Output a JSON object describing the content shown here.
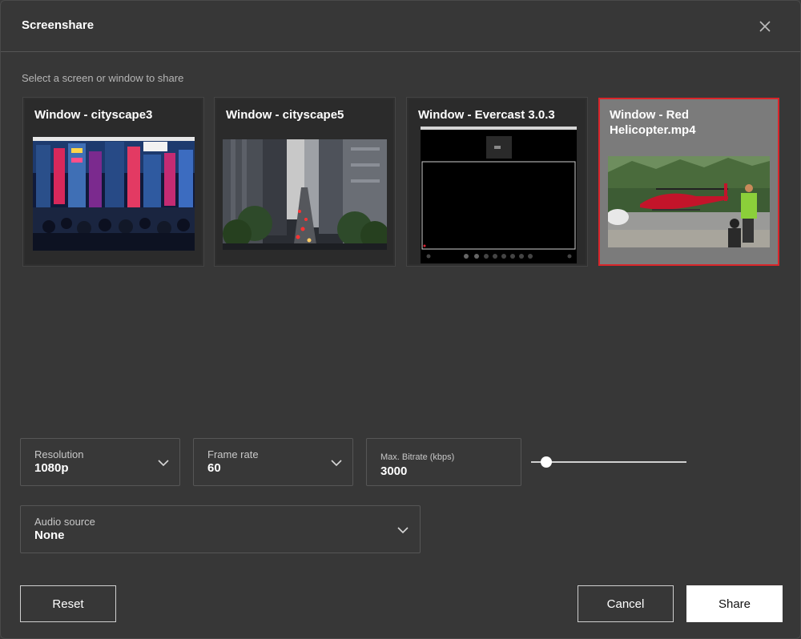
{
  "dialog": {
    "title": "Screenshare",
    "prompt": "Select a screen or window to share"
  },
  "sources": [
    {
      "label": "Window - cityscape3",
      "selected": false
    },
    {
      "label": "Window - cityscape5",
      "selected": false
    },
    {
      "label": "Window - Evercast 3.0.3",
      "selected": false
    },
    {
      "label": "Window - Red Helicopter.mp4",
      "selected": true
    }
  ],
  "settings": {
    "resolution": {
      "label": "Resolution",
      "value": "1080p"
    },
    "frame_rate": {
      "label": "Frame rate",
      "value": "60"
    },
    "bitrate": {
      "label": "Max. Bitrate (kbps)",
      "value": "3000",
      "slider_fraction": 0.1
    },
    "audio_source": {
      "label": "Audio source",
      "value": "None"
    }
  },
  "buttons": {
    "reset": "Reset",
    "cancel": "Cancel",
    "share": "Share"
  },
  "colors": {
    "background": "#373737",
    "selected_border": "#d9252a",
    "primary_button": "#ffffff"
  },
  "icons": [
    "close-icon",
    "chevron-down-icon"
  ]
}
